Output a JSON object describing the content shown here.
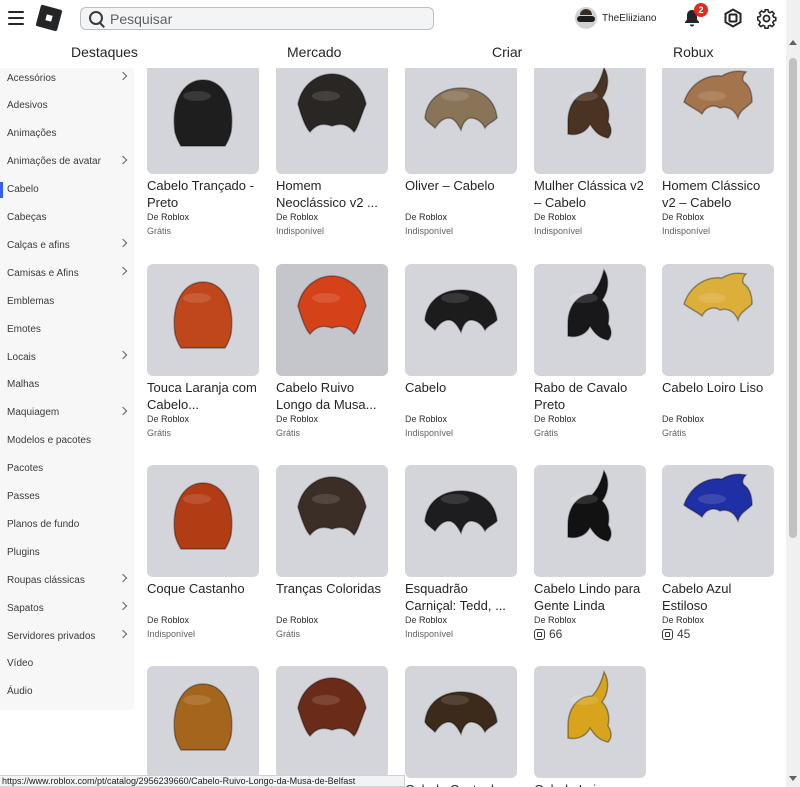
{
  "header": {
    "search_placeholder": "Pesquisar",
    "username": "TheEliiziano",
    "notification_count": "2"
  },
  "nav": {
    "tabs": [
      "Destaques",
      "Mercado",
      "Criar",
      "Robux"
    ]
  },
  "sidebar": {
    "items": [
      {
        "label": "Acessórios",
        "chevron": true
      },
      {
        "label": "Adesivos",
        "chevron": false
      },
      {
        "label": "Animações",
        "chevron": false
      },
      {
        "label": "Animações de avatar",
        "chevron": true
      },
      {
        "label": "Cabelo",
        "chevron": false,
        "active": true
      },
      {
        "label": "Cabeças",
        "chevron": false
      },
      {
        "label": "Calças e afins",
        "chevron": true
      },
      {
        "label": "Camisas e Afins",
        "chevron": true
      },
      {
        "label": "Emblemas",
        "chevron": false
      },
      {
        "label": "Emotes",
        "chevron": false
      },
      {
        "label": "Locais",
        "chevron": true
      },
      {
        "label": "Malhas",
        "chevron": false
      },
      {
        "label": "Maquiagem",
        "chevron": true
      },
      {
        "label": "Modelos e pacotes",
        "chevron": false
      },
      {
        "label": "Pacotes",
        "chevron": false
      },
      {
        "label": "Passes",
        "chevron": false
      },
      {
        "label": "Planos de fundo",
        "chevron": false
      },
      {
        "label": "Plugins",
        "chevron": false
      },
      {
        "label": "Roupas clássicas",
        "chevron": true
      },
      {
        "label": "Sapatos",
        "chevron": true
      },
      {
        "label": "Servidores privados",
        "chevron": true
      },
      {
        "label": "Vídeo",
        "chevron": false
      },
      {
        "label": "Áudio",
        "chevron": false
      }
    ]
  },
  "items": [
    {
      "name": "Cabelo Trançado - Preto",
      "creator_prefix": "De",
      "creator": "Roblox",
      "status": "Grátis",
      "color": "#1e1e1e"
    },
    {
      "name": "Homem Neoclássico v2 ...",
      "creator_prefix": "De",
      "creator": "Roblox",
      "status": "Indisponível",
      "color": "#2a2623"
    },
    {
      "name": "Oliver – Cabelo",
      "creator_prefix": "De",
      "creator": "Roblox",
      "status": "Indisponível",
      "color": "#8a7458"
    },
    {
      "name": "Mulher Clássica v2 – Cabelo",
      "creator_prefix": "De",
      "creator": "Roblox",
      "status": "Indisponível",
      "color": "#4a3322"
    },
    {
      "name": "Homem Clássico v2 – Cabelo",
      "creator_prefix": "De",
      "creator": "Roblox",
      "status": "Indisponível",
      "color": "#a4744c"
    },
    {
      "name": "Touca Laranja com Cabelo...",
      "creator_prefix": "De",
      "creator": "Roblox",
      "status": "Grátis",
      "color": "#c0461c"
    },
    {
      "name": "Cabelo Ruivo Longo da Musa...",
      "creator_prefix": "De",
      "creator": "Roblox",
      "status": "Grátis",
      "color": "#d5421a"
    },
    {
      "name": "Cabelo",
      "creator_prefix": "De",
      "creator": "Roblox",
      "status": "Indisponível",
      "color": "#1c1c1d"
    },
    {
      "name": "Rabo de Cavalo Preto",
      "creator_prefix": "De",
      "creator": "Roblox",
      "status": "Grátis",
      "color": "#18181a"
    },
    {
      "name": "Cabelo Loiro Liso",
      "creator_prefix": "De",
      "creator": "Roblox",
      "status": "Grátis",
      "color": "#dcae3a"
    },
    {
      "name": "Coque Castanho",
      "creator_prefix": "De",
      "creator": "Roblox",
      "status": "Indisponível",
      "color": "#b23c14"
    },
    {
      "name": "Tranças Coloridas",
      "creator_prefix": "De",
      "creator": "Roblox",
      "status": "Grátis",
      "color": "#3b2e26"
    },
    {
      "name": "Esquadrão Carniçal: Tedd, ...",
      "creator_prefix": "De",
      "creator": "Roblox",
      "status": "Indisponível",
      "color": "#1d1d1f"
    },
    {
      "name": "Cabelo Lindo para Gente Linda",
      "creator_prefix": "De",
      "creator": "Roblox",
      "price": "66",
      "color": "#121212"
    },
    {
      "name": "Cabelo Azul Estiloso",
      "creator_prefix": "De",
      "creator": "Roblox",
      "price": "45",
      "color": "#1f2fa5"
    },
    {
      "name": "",
      "creator_prefix": "",
      "creator": "",
      "status": "",
      "color": "#a5651c"
    },
    {
      "name": "",
      "creator_prefix": "",
      "creator": "",
      "status": "",
      "color": "#6a2c18"
    },
    {
      "name": "Cabelo Castanho",
      "creator_prefix": "",
      "creator": "",
      "status": "",
      "color": "#3c2a1a"
    },
    {
      "name": "Cabelo Loiro",
      "creator_prefix": "",
      "creator": "",
      "status": "",
      "color": "#d8a41e"
    }
  ],
  "statusbar": {
    "url": "https://www.roblox.com/pt/catalog/2956239660/Cabelo-Ruivo-Longo-da-Musa-de-Belfast"
  }
}
